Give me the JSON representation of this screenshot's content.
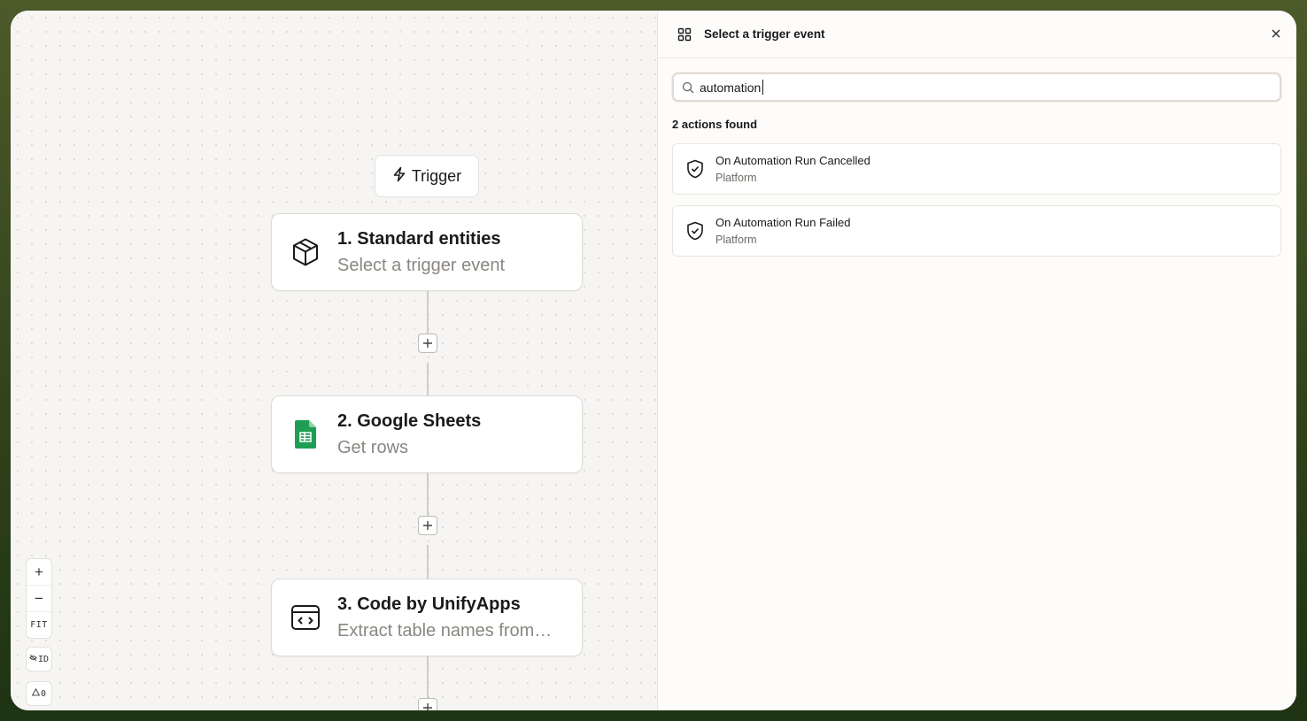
{
  "canvas": {
    "trigger_label": "Trigger",
    "nodes": [
      {
        "title": "1. Standard entities",
        "subtitle": "Select a trigger event",
        "icon": "cube-icon"
      },
      {
        "title": "2. Google Sheets",
        "subtitle": "Get rows",
        "icon": "google-sheets-icon"
      },
      {
        "title": "3. Code by UnifyApps",
        "subtitle": "Extract table names from…",
        "icon": "code-window-icon"
      }
    ],
    "controls": {
      "zoom_in": "+",
      "zoom_out": "−",
      "fit": "FIT",
      "id_toggle": "ID",
      "warnings_count": "0"
    }
  },
  "panel": {
    "title": "Select a trigger event",
    "search": {
      "value": "automation",
      "placeholder": ""
    },
    "results_count": "2 actions found",
    "results": [
      {
        "title": "On Automation Run Cancelled",
        "subtitle": "Platform",
        "icon": "shield-check-icon"
      },
      {
        "title": "On Automation Run Failed",
        "subtitle": "Platform",
        "icon": "shield-check-icon"
      }
    ]
  },
  "colors": {
    "accent_green": "#1f9d55",
    "canvas_bg": "#f6f5f3",
    "panel_bg": "#fdfcfb"
  }
}
